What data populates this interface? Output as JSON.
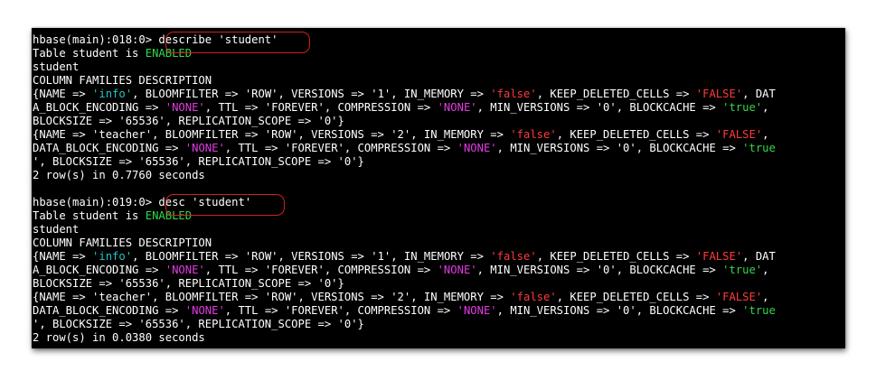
{
  "colors": {
    "background": "#000000",
    "text": "#ffffff",
    "cyan": "#22c6c6",
    "red": "#ff3a3a",
    "green": "#32d74b",
    "magenta": "#e23be2",
    "annotation": "#d22020"
  },
  "terminal": {
    "lines": [
      [
        {
          "t": "hbase(main):018:0> describe 'student'",
          "c": "default"
        }
      ],
      [
        {
          "t": "Table student is ",
          "c": "default"
        },
        {
          "t": "ENABLED",
          "c": "green"
        }
      ],
      [
        {
          "t": "student",
          "c": "default"
        }
      ],
      [
        {
          "t": "COLUMN FAMILIES DESCRIPTION",
          "c": "default"
        }
      ],
      [
        {
          "t": "{NAME => ",
          "c": "default"
        },
        {
          "t": "'info'",
          "c": "cyan"
        },
        {
          "t": ", BLOOMFILTER => 'ROW', VERSIONS => '1', IN_MEMORY => ",
          "c": "default"
        },
        {
          "t": "'false'",
          "c": "red"
        },
        {
          "t": ", KEEP_DELETED_CELLS => ",
          "c": "default"
        },
        {
          "t": "'FALSE'",
          "c": "red"
        },
        {
          "t": ", DAT",
          "c": "default"
        }
      ],
      [
        {
          "t": "A_BLOCK_ENCODING => ",
          "c": "default"
        },
        {
          "t": "'NONE'",
          "c": "magenta"
        },
        {
          "t": ", TTL => 'FOREVER', COMPRESSION => ",
          "c": "default"
        },
        {
          "t": "'NONE'",
          "c": "magenta"
        },
        {
          "t": ", MIN_VERSIONS => '0', BLOCKCACHE => ",
          "c": "default"
        },
        {
          "t": "'true'",
          "c": "green"
        },
        {
          "t": ",",
          "c": "default"
        }
      ],
      [
        {
          "t": "BLOCKSIZE => '65536', REPLICATION_SCOPE => '0'}",
          "c": "default"
        }
      ],
      [
        {
          "t": "{NAME => 'teacher', BLOOMFILTER => 'ROW', VERSIONS => '2', IN_MEMORY => ",
          "c": "default"
        },
        {
          "t": "'false'",
          "c": "red"
        },
        {
          "t": ", KEEP_DELETED_CELLS => ",
          "c": "default"
        },
        {
          "t": "'FALSE'",
          "c": "red"
        },
        {
          "t": ",",
          "c": "default"
        }
      ],
      [
        {
          "t": "DATA_BLOCK_ENCODING => ",
          "c": "default"
        },
        {
          "t": "'NONE'",
          "c": "magenta"
        },
        {
          "t": ", TTL => 'FOREVER', COMPRESSION => ",
          "c": "default"
        },
        {
          "t": "'NONE'",
          "c": "magenta"
        },
        {
          "t": ", MIN_VERSIONS => '0', BLOCKCACHE => ",
          "c": "default"
        },
        {
          "t": "'true",
          "c": "green"
        }
      ],
      [
        {
          "t": "', BLOCKSIZE => '65536', REPLICATION_SCOPE => '0'}",
          "c": "default"
        }
      ],
      [
        {
          "t": "2 row(s) in 0.7760 seconds",
          "c": "default"
        }
      ],
      [
        {
          "t": "",
          "c": "default"
        }
      ],
      [
        {
          "t": "hbase(main):019:0> desc 'student'",
          "c": "default"
        }
      ],
      [
        {
          "t": "Table student is ",
          "c": "default"
        },
        {
          "t": "ENABLED",
          "c": "green"
        }
      ],
      [
        {
          "t": "student",
          "c": "default"
        }
      ],
      [
        {
          "t": "COLUMN FAMILIES DESCRIPTION",
          "c": "default"
        }
      ],
      [
        {
          "t": "{NAME => ",
          "c": "default"
        },
        {
          "t": "'info'",
          "c": "cyan"
        },
        {
          "t": ", BLOOMFILTER => 'ROW', VERSIONS => '1', IN_MEMORY => ",
          "c": "default"
        },
        {
          "t": "'false'",
          "c": "red"
        },
        {
          "t": ", KEEP_DELETED_CELLS => ",
          "c": "default"
        },
        {
          "t": "'FALSE'",
          "c": "red"
        },
        {
          "t": ", DAT",
          "c": "default"
        }
      ],
      [
        {
          "t": "A_BLOCK_ENCODING => ",
          "c": "default"
        },
        {
          "t": "'NONE'",
          "c": "magenta"
        },
        {
          "t": ", TTL => 'FOREVER', COMPRESSION => ",
          "c": "default"
        },
        {
          "t": "'NONE'",
          "c": "magenta"
        },
        {
          "t": ", MIN_VERSIONS => '0', BLOCKCACHE => ",
          "c": "default"
        },
        {
          "t": "'true'",
          "c": "green"
        },
        {
          "t": ",",
          "c": "default"
        }
      ],
      [
        {
          "t": "BLOCKSIZE => '65536', REPLICATION_SCOPE => '0'}",
          "c": "default"
        }
      ],
      [
        {
          "t": "{NAME => 'teacher', BLOOMFILTER => 'ROW', VERSIONS => '2', IN_MEMORY => ",
          "c": "default"
        },
        {
          "t": "'false'",
          "c": "red"
        },
        {
          "t": ", KEEP_DELETED_CELLS => ",
          "c": "default"
        },
        {
          "t": "'FALSE'",
          "c": "red"
        },
        {
          "t": ",",
          "c": "default"
        }
      ],
      [
        {
          "t": "DATA_BLOCK_ENCODING => ",
          "c": "default"
        },
        {
          "t": "'NONE'",
          "c": "magenta"
        },
        {
          "t": ", TTL => 'FOREVER', COMPRESSION => ",
          "c": "default"
        },
        {
          "t": "'NONE'",
          "c": "magenta"
        },
        {
          "t": ", MIN_VERSIONS => '0', BLOCKCACHE => ",
          "c": "default"
        },
        {
          "t": "'true",
          "c": "green"
        }
      ],
      [
        {
          "t": "', BLOCKSIZE => '65536', REPLICATION_SCOPE => '0'}",
          "c": "default"
        }
      ],
      [
        {
          "t": "2 row(s) in 0.0380 seconds",
          "c": "default"
        }
      ]
    ]
  }
}
